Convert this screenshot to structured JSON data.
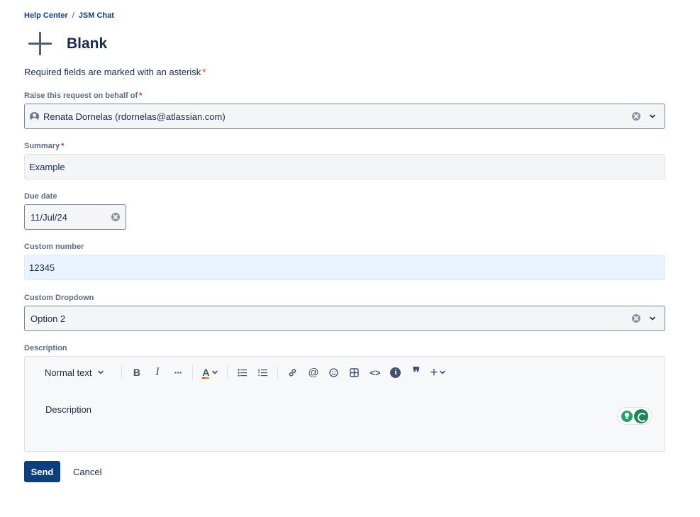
{
  "breadcrumb": {
    "items": [
      {
        "label": "Help Center"
      },
      {
        "label": "JSM Chat"
      }
    ],
    "separator": "/"
  },
  "page": {
    "title": "Blank",
    "required_note": "Required fields are marked with an asterisk",
    "required_mark": "*"
  },
  "form": {
    "on_behalf_of": {
      "label": "Raise this request on behalf of",
      "value": "Renata Dornelas (rdornelas@atlassian.com)"
    },
    "summary": {
      "label": "Summary",
      "value": "Example"
    },
    "due_date": {
      "label": "Due date",
      "value": "11/Jul/24"
    },
    "custom_number": {
      "label": "Custom number",
      "value": "12345"
    },
    "custom_dropdown": {
      "label": "Custom Dropdown",
      "value": "Option 2"
    },
    "description": {
      "label": "Description",
      "placeholder": "Description",
      "toolbar": {
        "text_style": "Normal text",
        "bold": "B",
        "italic": "I",
        "more": "···",
        "text_color": "A",
        "bullet_list": "bullet-list-icon",
        "numbered_list": "numbered-list-icon",
        "link": "link-icon",
        "mention": "@",
        "emoji": "emoji-icon",
        "table": "table-icon",
        "code": "<>",
        "info": "i",
        "quote": "❞",
        "insert": "+"
      }
    }
  },
  "actions": {
    "send": "Send",
    "cancel": "Cancel"
  },
  "colors": {
    "primary": "#0c3f7e",
    "required": "#de350b",
    "label": "#5e6c84",
    "field_bg": "#f4f5f7",
    "focused_bg": "#e9f2ff"
  }
}
